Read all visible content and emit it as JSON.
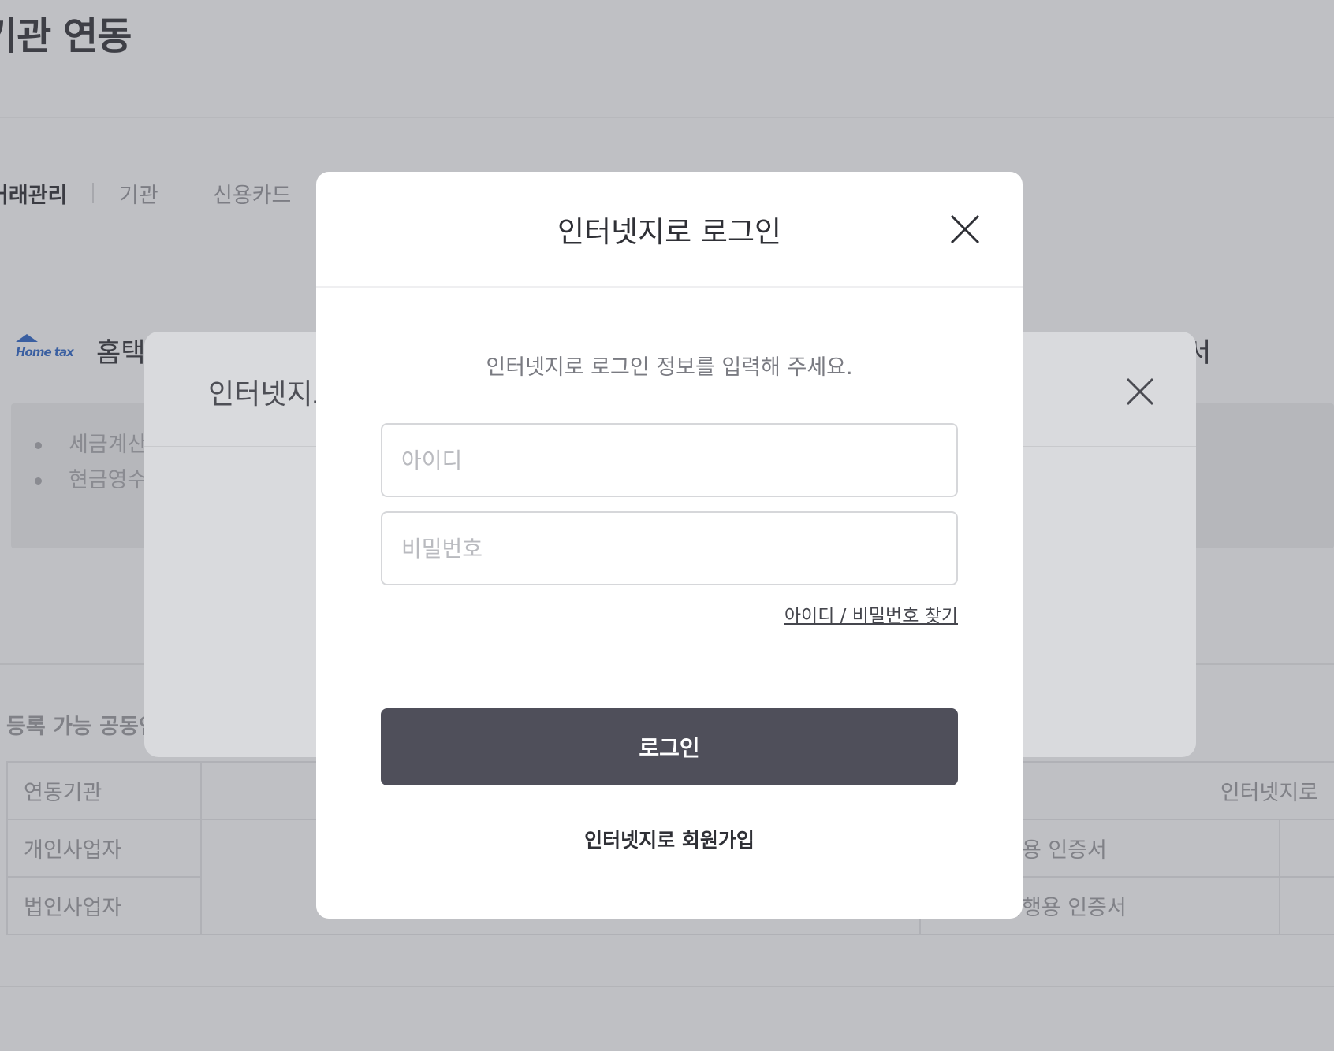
{
  "page": {
    "title": "기관 연동"
  },
  "tabs": [
    {
      "label": "거래관리"
    },
    {
      "label": "기관"
    },
    {
      "label": "신용카드"
    }
  ],
  "institution": {
    "name": "홈택",
    "right_fragment": "서"
  },
  "info_items": [
    "세금계산",
    "현금영수"
  ],
  "certificates": {
    "section_title": "등록 가능 공동인",
    "rows": [
      [
        "연동기관",
        "",
        "",
        "인터넷지로"
      ],
      [
        "개인사업자",
        "",
        "개인 은행용 인증서",
        ""
      ],
      [
        "법인사업자",
        "",
        "사업자 은행용 인증서",
        ""
      ]
    ]
  },
  "back_modal": {
    "title": "인터넷지로"
  },
  "login_modal": {
    "title": "인터넷지로 로그인",
    "description": "인터넷지로 로그인 정보를 입력해 주세요.",
    "id_placeholder": "아이디",
    "pw_placeholder": "비밀번호",
    "find_link": "아이디 / 비밀번호 찾기",
    "login_button": "로그인",
    "signup_link": "인터넷지로 회원가입",
    "close_icon": "close-icon"
  },
  "colors": {
    "overlay_bg": "#bfc0c4",
    "modal_bg": "#ffffff",
    "primary_button": "#4f4f5a",
    "input_border": "#d6d7da"
  }
}
